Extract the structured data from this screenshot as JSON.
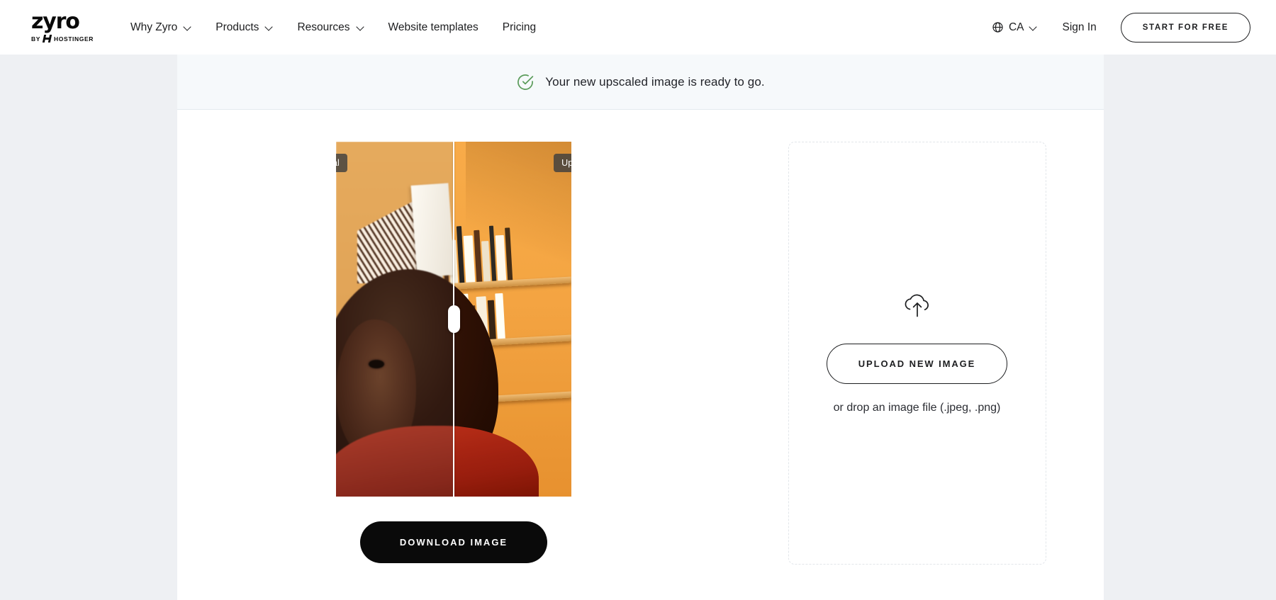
{
  "header": {
    "brand": {
      "word": "zyro",
      "by": "BY",
      "parent": "HOSTINGER",
      "mark_icon": "hostinger-h-icon"
    },
    "nav": [
      {
        "label": "Why Zyro",
        "has_dropdown": true,
        "icon": "chevron-down-icon"
      },
      {
        "label": "Products",
        "has_dropdown": true,
        "icon": "chevron-down-icon"
      },
      {
        "label": "Resources",
        "has_dropdown": true,
        "icon": "chevron-down-icon"
      },
      {
        "label": "Website templates",
        "has_dropdown": false
      },
      {
        "label": "Pricing",
        "has_dropdown": false
      }
    ],
    "locale": {
      "label": "CA",
      "globe_icon": "globe-icon",
      "chevron_icon": "chevron-down-icon"
    },
    "sign_in": "Sign In",
    "cta": "START FOR FREE"
  },
  "status": {
    "icon": "circle-check-icon",
    "message": "Your new upscaled image is ready to go.",
    "icon_color": "#5b9c5b",
    "background": "#f6f9fb"
  },
  "result": {
    "badge_original": "Original",
    "badge_upscaled": "Upscaled",
    "divider_position_percent": 50,
    "handle_icon": "compare-slider-handle",
    "download_label": "DOWNLOAD IMAGE"
  },
  "dropzone": {
    "icon": "cloud-upload-icon",
    "upload_label": "UPLOAD NEW IMAGE",
    "hint": "or drop an image file (.jpeg, .png)"
  },
  "colors": {
    "page_background": "#eef0f3",
    "panel_background": "#ffffff",
    "text": "#1d1e20",
    "button_dark": "#0a0a0a",
    "badge_background": "rgba(62,62,62,0.82)",
    "dropzone_border": "#e2e6ea"
  }
}
